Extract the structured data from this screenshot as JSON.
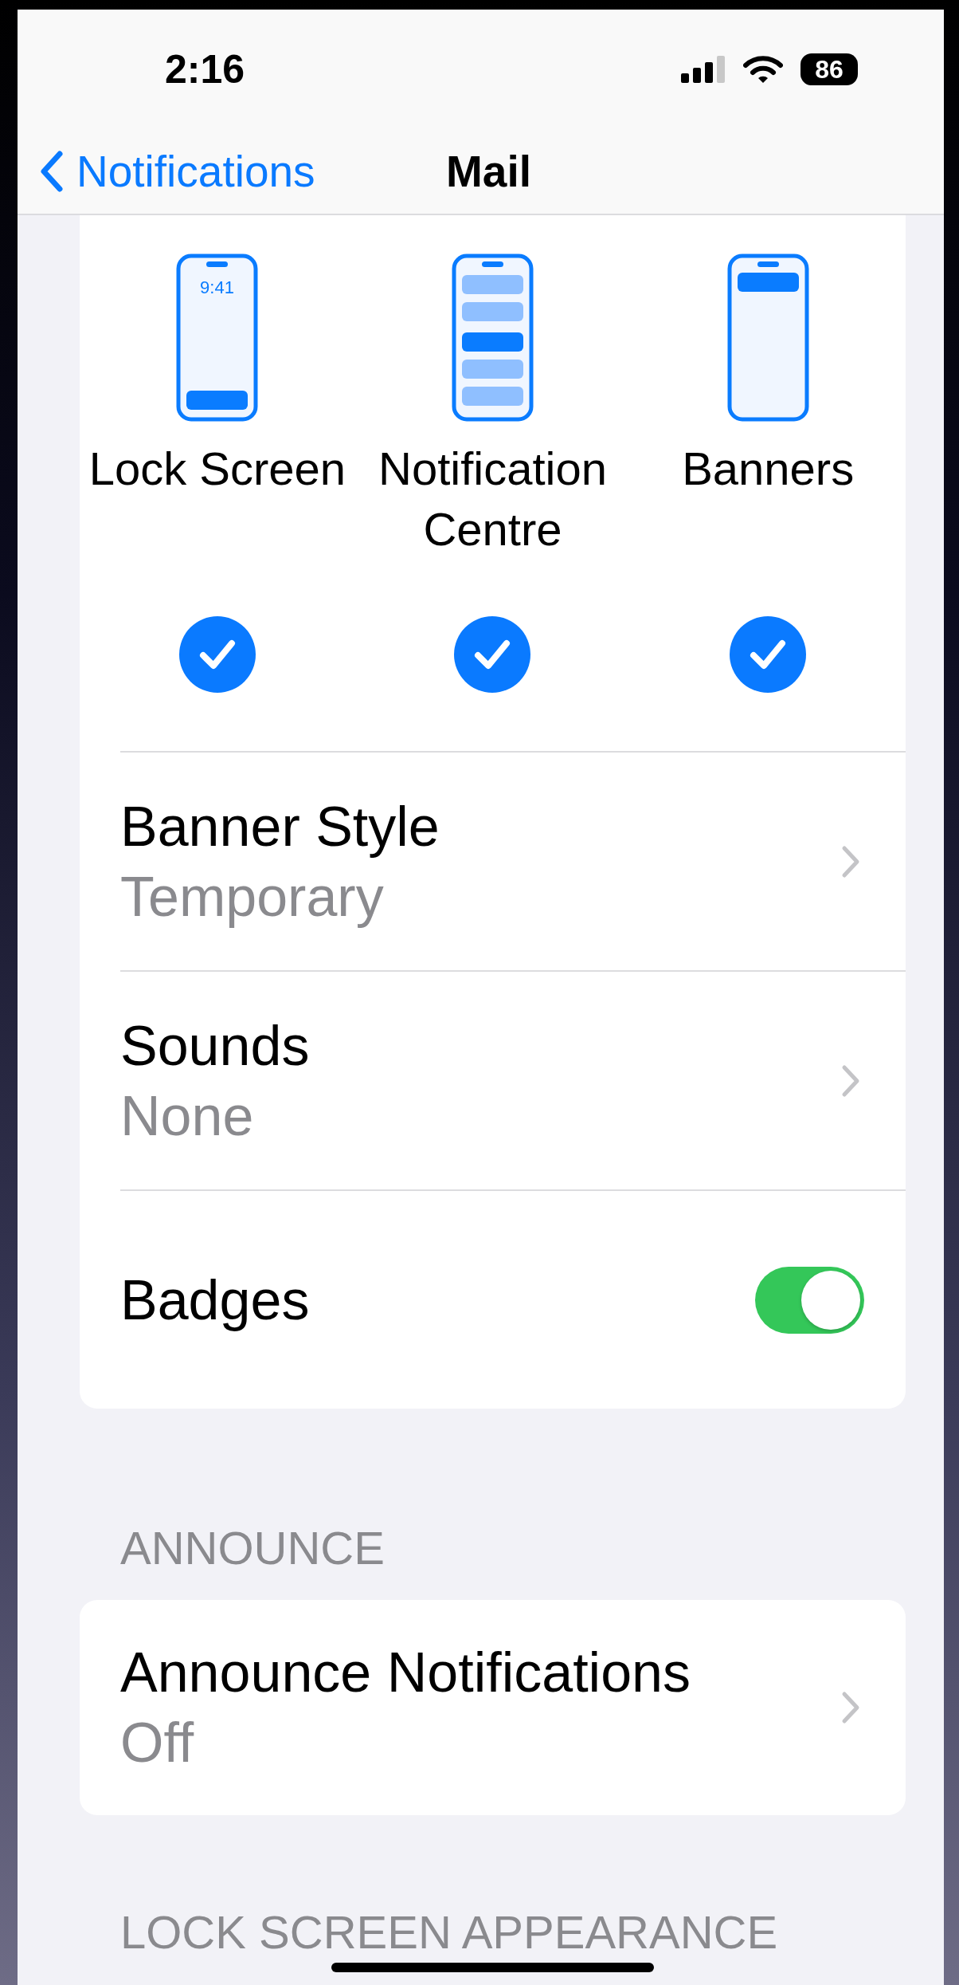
{
  "status_bar": {
    "time": "2:16",
    "battery": "86"
  },
  "nav": {
    "back": "Notifications",
    "title": "Mail"
  },
  "alert_styles": [
    {
      "kind": "lock",
      "label": "Lock Screen",
      "preview_time": "9:41",
      "checked": true
    },
    {
      "kind": "centre",
      "label": "Notification Centre",
      "checked": true
    },
    {
      "kind": "banners",
      "label": "Banners",
      "checked": true
    }
  ],
  "settings": [
    {
      "kind": "link",
      "title": "Banner Style",
      "value": "Temporary"
    },
    {
      "kind": "link",
      "title": "Sounds",
      "value": "None"
    },
    {
      "kind": "toggle",
      "title": "Badges",
      "on": true
    }
  ],
  "sections": [
    {
      "header": "ANNOUNCE",
      "rows": [
        {
          "kind": "link",
          "title": "Announce Notifications",
          "value": "Off"
        }
      ]
    },
    {
      "header": "LOCK SCREEN APPEARANCE"
    }
  ]
}
